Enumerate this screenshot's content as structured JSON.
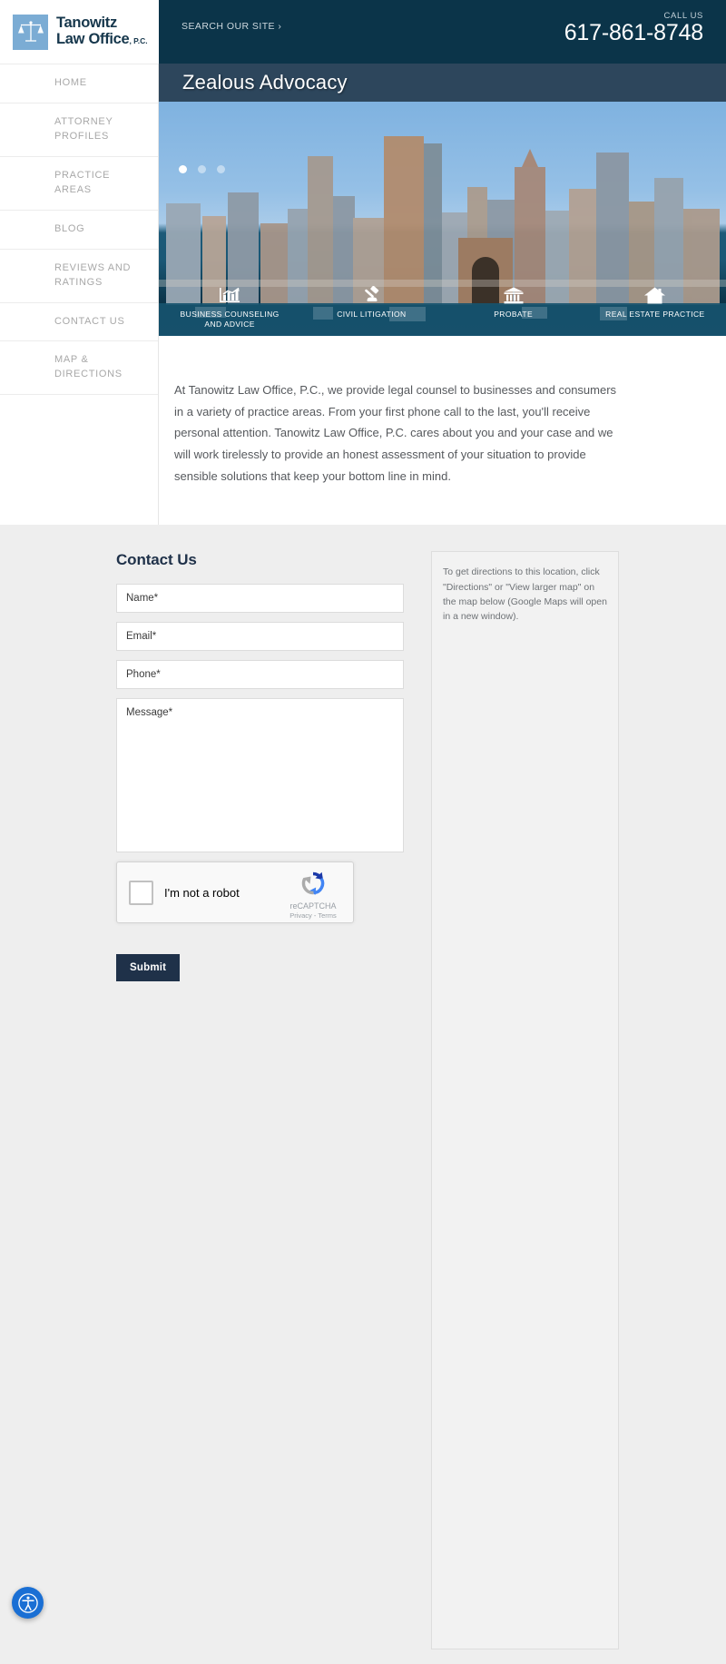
{
  "header": {
    "logo": {
      "icon": "scales-of-justice-icon",
      "line1": "Tanowitz",
      "line2": "Law Office",
      "suffix": ", P.C."
    },
    "search_label": "SEARCH OUR SITE ›",
    "call_us_label": "CALL US",
    "phone": "617-861-8748"
  },
  "sidebar": {
    "items": [
      {
        "label": "HOME"
      },
      {
        "label": "ATTORNEY PROFILES"
      },
      {
        "label": "PRACTICE AREAS"
      },
      {
        "label": "BLOG"
      },
      {
        "label": "REVIEWS AND RATINGS"
      },
      {
        "label": "CONTACT US"
      },
      {
        "label": "MAP & DIRECTIONS"
      }
    ]
  },
  "hero": {
    "title": "Zealous Advocacy",
    "slide_count": 3,
    "active_slide": 1,
    "image_alt": "Boston harbor skyline"
  },
  "practice_areas": [
    {
      "label": "BUSINESS COUNSELING AND ADVICE",
      "icon": "bar-chart-icon"
    },
    {
      "label": "CIVIL LITIGATION",
      "icon": "gavel-icon"
    },
    {
      "label": "PROBATE",
      "icon": "courthouse-icon"
    },
    {
      "label": "REAL ESTATE PRACTICE",
      "icon": "house-icon"
    }
  ],
  "intro": {
    "paragraph": "At Tanowitz Law Office, P.C., we provide legal counsel to businesses and consumers in a variety of practice areas.  From your first phone call to the last, you'll receive personal attention.  Tanowitz Law Office, P.C. cares about you and your case and we will work tirelessly to provide an honest assessment of your situation to provide sensible solutions that keep your bottom line in mind."
  },
  "contact_form": {
    "heading": "Contact Us",
    "fields": [
      {
        "name": "name",
        "placeholder": "Name*",
        "value": ""
      },
      {
        "name": "email",
        "placeholder": "Email*",
        "value": ""
      },
      {
        "name": "phone",
        "placeholder": "Phone*",
        "value": ""
      },
      {
        "name": "message",
        "placeholder": "Message*",
        "value": ""
      }
    ],
    "recaptcha": {
      "checkbox_label": "I'm not a robot",
      "brand": "reCAPTCHA",
      "links": "Privacy - Terms"
    },
    "submit_label": "Submit"
  },
  "directions_box": {
    "text": "To get directions to this location, click \"Directions\" or \"View larger map\" on the map below (Google Maps will open in a new window)."
  },
  "accessibility": {
    "icon": "accessibility-icon",
    "color": "#1a6fd4"
  },
  "colors": {
    "header_navy": "#0b3449",
    "hero_bar": "#2d465c",
    "logo_blue": "#7bacd4",
    "button_navy": "#1f3149",
    "section_gray": "#eeeeee"
  }
}
